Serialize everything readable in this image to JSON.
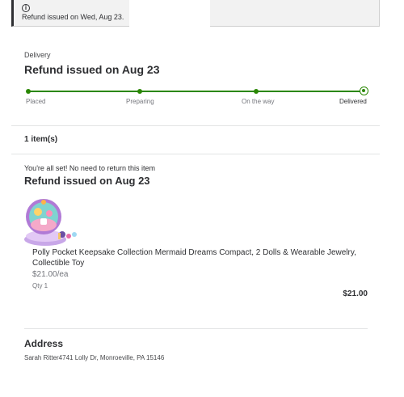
{
  "banner": {
    "icon": "info-icon",
    "icon_glyph": "i",
    "message": "Refund issued on Wed, Aug 23."
  },
  "delivery": {
    "label": "Delivery",
    "title": "Refund issued on Aug 23",
    "steps": [
      {
        "label": "Placed",
        "completed": true
      },
      {
        "label": "Preparing",
        "completed": true
      },
      {
        "label": "On the way",
        "completed": true
      },
      {
        "label": "Delivered",
        "completed": true,
        "current": true
      }
    ],
    "progress": 1.0,
    "accent_color": "#2a8703"
  },
  "items": {
    "count_label": "1 item(s)"
  },
  "item_group": {
    "note": "You're all set! No need to return this item",
    "title": "Refund issued on Aug 23",
    "product": {
      "image_icon": "product-image",
      "name": "Polly Pocket Keepsake Collection Mermaid Dreams Compact, 2 Dolls & Wearable Jewelry, Collectible Toy",
      "unit_price": "$21.00/ea",
      "qty": "Qty 1",
      "total": "$21.00"
    }
  },
  "address": {
    "title": "Address",
    "text": "Sarah Ritter4741 Lolly Dr, Monroeville, PA 15146"
  }
}
